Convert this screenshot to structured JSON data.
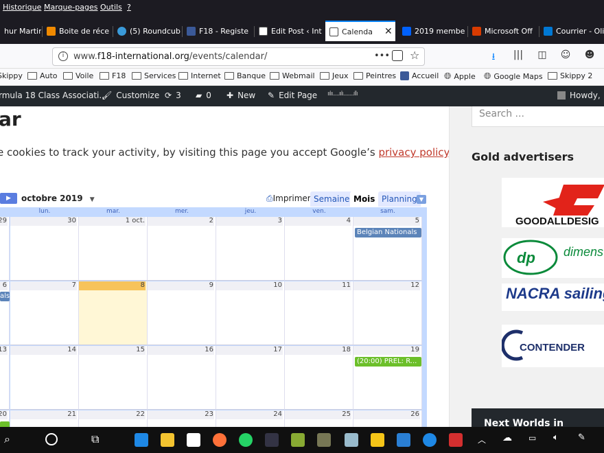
{
  "menubar": {
    "items": [
      "Historique",
      "Marque-pages",
      "Outils",
      "?"
    ]
  },
  "tabs": [
    {
      "label": "hur Martin",
      "color": "#888",
      "active": false
    },
    {
      "label": "Boite de réce",
      "color": "#f08a00",
      "active": false
    },
    {
      "label": "(5) Roundcub",
      "color": "#3a9ad9",
      "active": false
    },
    {
      "label": "F18 - Registe",
      "color": "#3b5998",
      "active": false
    },
    {
      "label": "Edit Post ‹ Int",
      "color": "#555",
      "active": false
    },
    {
      "label": "Calenda",
      "color": "#444",
      "active": true
    },
    {
      "label": "2019 membe",
      "color": "#0061fe",
      "active": false
    },
    {
      "label": "Microsoft Off",
      "color": "#d83b01",
      "active": false
    },
    {
      "label": "Courrier - Oli",
      "color": "#0078d4",
      "active": false
    }
  ],
  "navbar": {
    "url_prefix": "www.",
    "url_domain": "f18-international.org",
    "url_path": "/events/calendar/",
    "more": "•••"
  },
  "bookmarks": [
    {
      "label": "Skippy",
      "type": "folder"
    },
    {
      "label": "Auto",
      "type": "folder"
    },
    {
      "label": "Voile",
      "type": "folder"
    },
    {
      "label": "F18",
      "type": "folder"
    },
    {
      "label": "Services",
      "type": "folder"
    },
    {
      "label": "Internet",
      "type": "folder"
    },
    {
      "label": "Banque",
      "type": "folder"
    },
    {
      "label": "Webmail",
      "type": "folder"
    },
    {
      "label": "Jeux",
      "type": "folder"
    },
    {
      "label": "Peintres",
      "type": "folder"
    },
    {
      "label": "Accueil",
      "type": "facebook"
    },
    {
      "label": "Apple",
      "type": "globe"
    },
    {
      "label": "Google Maps",
      "type": "globe"
    },
    {
      "label": "Skippy 2",
      "type": "folder"
    }
  ],
  "wpbar": {
    "site": "rmula 18 Class Associati...",
    "customize": "Customize",
    "updates": "3",
    "comments": "0",
    "new": "New",
    "edit": "Edit Page",
    "howdy": "Howdy,"
  },
  "page": {
    "title": "ar",
    "cookie_text": "e cookies to track your activity, by visiting this page you accept Google’s ",
    "cookie_link": "privacy policy",
    "cookie_end": "."
  },
  "calendar": {
    "month_label": "octobre 2019",
    "print_label": "Imprimer",
    "views": [
      "Semaine",
      "Mois",
      "Planning"
    ],
    "selected_view": "Mois",
    "day_headers": [
      "lun.",
      "mar.",
      "mer.",
      "jeu.",
      "ven.",
      "sam."
    ],
    "weeks": [
      [
        "29",
        "30",
        "1 oct.",
        "2",
        "3",
        "4",
        "5"
      ],
      [
        "6",
        "7",
        "8",
        "9",
        "10",
        "11",
        "12"
      ],
      [
        "13",
        "14",
        "15",
        "16",
        "17",
        "18",
        "19"
      ],
      [
        "20",
        "21",
        "22",
        "23",
        "24",
        "25",
        "26"
      ]
    ],
    "today": "8",
    "events": {
      "belgian": "Belgian Nationals",
      "belgian_cont": "als",
      "prel": "(20:00) PREL: R..."
    }
  },
  "sidebar": {
    "search_placeholder": "Search ...",
    "gold_heading": "Gold advertisers",
    "ads": [
      "GOODALLDESIG",
      "dimens polyant",
      "NACRA sailing",
      "CONTENDER"
    ],
    "next_worlds": "Next Worlds in Formia"
  }
}
